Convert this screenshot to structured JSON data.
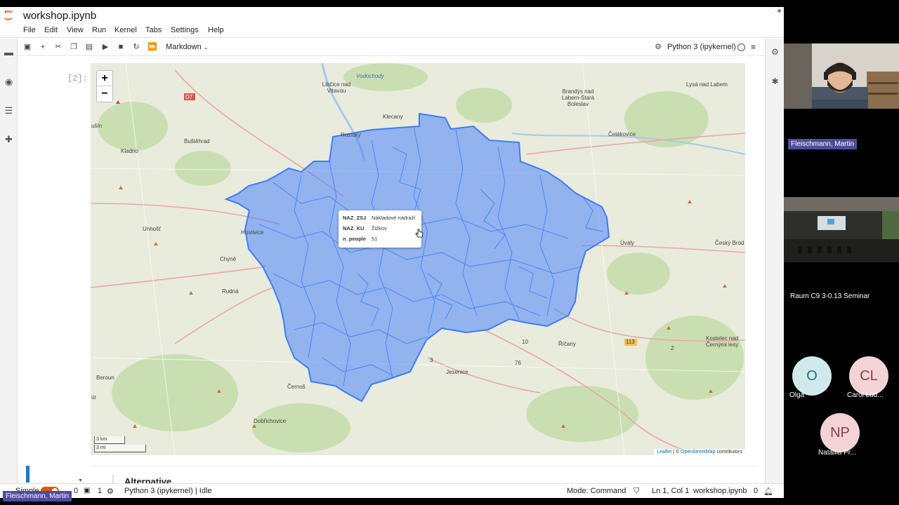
{
  "window": {
    "title": "workshop.ipynb"
  },
  "menu": [
    "File",
    "Edit",
    "View",
    "Run",
    "Kernel",
    "Tabs",
    "Settings",
    "Help"
  ],
  "toolbar": {
    "cell_type": "Markdown",
    "kernel": "Python 3 (ipykernel)"
  },
  "cell": {
    "prompt": "[2]:"
  },
  "map": {
    "places": [
      "Vodochody",
      "Libčice nad Vltavou",
      "D7",
      "Klecany",
      "Brandýs nad Labem-Stará Boleslav",
      "Lysá nad Labem",
      "Roztoky",
      "ušín",
      "Buštěhrad",
      "Čelákovice",
      "Kladno",
      "Unhošť",
      "Hostivice",
      "Chýně",
      "Úvaly",
      "Český Brod",
      "Rudná",
      "Říčany",
      "Kostelec nad Černými lesy",
      "Beroun",
      "Jesenice",
      "Černoš",
      "Dobřichovice",
      "úr",
      "113",
      "2",
      "10",
      "76",
      "3"
    ],
    "zoom_in": "+",
    "zoom_out": "−",
    "scale": [
      "3 km",
      "3 mi"
    ],
    "attribution": {
      "leaflet": "Leaflet",
      "sep": " | © ",
      "osm": "OpenStreetMap",
      "rest": " contributors"
    },
    "polygon_color": "#3b7bff",
    "tooltip": {
      "rows": [
        {
          "key": "NAZ_ZSJ",
          "value": "Nákladové nádraží"
        },
        {
          "key": "NAZ_KU",
          "value": "Žižkov"
        },
        {
          "key": "n_people",
          "value": "51"
        }
      ]
    }
  },
  "next_cell": {
    "heading": "Alternative"
  },
  "status": {
    "mode_label": "Simple",
    "zero": "0",
    "one": "1",
    "kernel_status": "Python 3 (ipykernel) | Idle",
    "command_mode": "Mode: Command",
    "position": "Ln 1, Col 1",
    "file": "workshop.ipynb",
    "notif_count": "0"
  },
  "call": {
    "speaker_name": "Fleischmann, Martin",
    "room_name": "Raum C9 3-0.13 Seminar",
    "participants": [
      {
        "initials": "O",
        "name": "Olga",
        "bg": "#cfe9ec",
        "fg": "#2d6b74"
      },
      {
        "initials": "CL",
        "name": "Carol Lud...",
        "bg": "#f3d3d6",
        "fg": "#8a3f49"
      },
      {
        "initials": "NP",
        "name": "Natallia Pr...",
        "bg": "#f3d3d6",
        "fg": "#8a3f49"
      }
    ],
    "bottom_chip": "Fleischmann, Martin"
  }
}
